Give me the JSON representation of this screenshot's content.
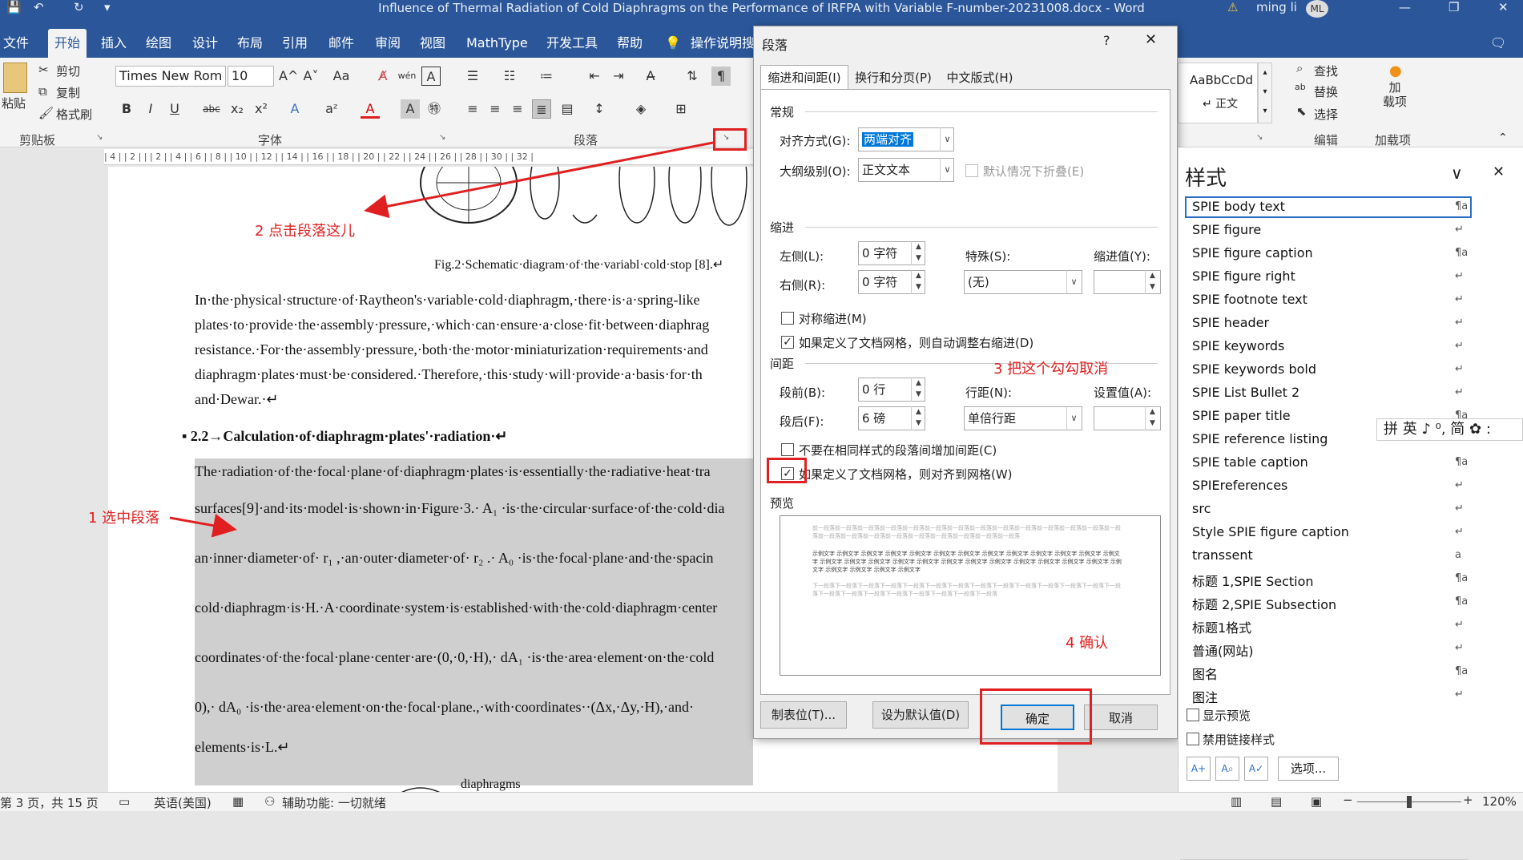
{
  "titlebar": {
    "title": "Influence of Thermal Radiation of Cold Diaphragms on the Performance of IRFPA with Variable F-number-20231008.docx  -  Word",
    "user": "ming li",
    "avatar": "ML",
    "min": "—",
    "restore": "❐",
    "close": "✕",
    "save": "💾",
    "undo": "↶",
    "redo": "↻",
    "customize": "▾",
    "warn": "⚠"
  },
  "ribbon": {
    "tabs": [
      "文件",
      "开始",
      "插入",
      "绘图",
      "设计",
      "布局",
      "引用",
      "邮件",
      "审阅",
      "视图",
      "MathType",
      "开发工具",
      "帮助",
      "操作说明搜"
    ],
    "tell_icon": "💡",
    "comment_icon": "🗨",
    "clipboard": {
      "paste": "粘贴",
      "cut": "剪切",
      "copy": "复制",
      "painter": "格式刷",
      "label": "剪贴板"
    },
    "font": {
      "name": "Times New Rom",
      "size": "10",
      "label": "字体",
      "bold": "B",
      "italic": "I",
      "underline": "U",
      "strike": "abc",
      "sub": "x₂",
      "sup": "x²",
      "grow": "A^",
      "shrink": "A˅",
      "case": "Aa",
      "clear": "A̸",
      "phon": "wén",
      "border": "A",
      "effect": "A",
      "hilite": "aᶻ",
      "color": "A",
      "shade": "A",
      "circ": "㊕"
    },
    "paragraph": {
      "label": "段落"
    },
    "styles": {
      "preview": "AaBbCcDd",
      "name": "↵ 正文"
    },
    "editing": {
      "find": "查找",
      "replace": "替换",
      "select": "选择",
      "label": "编辑"
    },
    "addins": {
      "name": "加\n载项",
      "label": "加载项",
      "icon": "●"
    }
  },
  "ruler": "| 4 |   | 2 |   |   | 2 |   | 4 |   | 6 |   | 8 |   | 10 |   | 12 |   | 14 |   | 16 |   | 18 |   | 20 |   | 22 |   | 24 |   | 26 |   | 28 |   | 30 |   | 32 |",
  "doc": {
    "caption": "Fig.2·Schematic·diagram·of·the·variabl·cold·stop [8].↵",
    "p1": [
      "In·the·physical·structure·of·Raytheon's·variable·cold·diaphragm,·there·is·a·spring-like",
      "plates·to·provide·the·assembly·pressure,·which·can·ensure·a·close·fit·between·diaphrag",
      "resistance.·For·the·assembly·pressure,·both·the·motor·miniaturization·requirements·and",
      "diaphragm·plates·must·be·considered.·Therefore,·this·study·will·provide·a·basis·for·th",
      "and·Dewar.·↵"
    ],
    "heading": "▪ 2.2→Calculation·of·diaphragm·plates'·radiation·↵",
    "p2": [
      "The·radiation·of·the·focal·plane·of·diaphragm·plates·is·essentially·the·radiative·heat·tra",
      "surfaces[9]·and·its·model·is·shown·in·Figure·3.·  A₁ ·is·the·circular·surface·of·the·cold·dia",
      "an·inner·diameter·of·  r₁ ,·an·outer·diameter·of·  r₂ .·  A₀ ·is·the·focal·plane·and·the·spacin",
      "cold·diaphragm·is·H.·A·coordinate·system·is·established·with·the·cold·diaphragm·center",
      "coordinates·of·the·focal·plane·center·are·(0,·0,·H),·  dA₁ ·is·the·area·element·on·the·cold",
      "0),·  dA₀ ·is·the·area·element·on·the·focal·plane.,·with·coordinates··(Δx,·Δy,·H),·and·",
      "elements·is·L.↵"
    ],
    "fig3": "diaphragms"
  },
  "dialog": {
    "title": "段落",
    "help": "?",
    "close": "✕",
    "tabs": [
      "缩进和间距(I)",
      "换行和分页(P)",
      "中文版式(H)"
    ],
    "general": "常规",
    "align_label": "对齐方式(G):",
    "align_value": "两端对齐",
    "outline_label": "大纲级别(O):",
    "outline_value": "正文文本",
    "collapse_label": "默认情况下折叠(E)",
    "indent": "缩进",
    "left_label": "左侧(L):",
    "left_value": "0 字符",
    "right_label": "右侧(R):",
    "right_value": "0 字符",
    "special_label": "特殊(S):",
    "special_value": "(无)",
    "indentby_label": "缩进值(Y):",
    "indentby_value": "",
    "mirror_label": "对称缩进(M)",
    "autoright_label": "如果定义了文档网格，则自动调整右缩进(D)",
    "spacing": "间距",
    "before_label": "段前(B):",
    "before_value": "0 行",
    "after_label": "段后(F):",
    "after_value": "6 磅",
    "line_label": "行距(N):",
    "line_value": "单倍行距",
    "at_label": "设置值(A):",
    "at_value": "",
    "nospace_label": "不要在相同样式的段落间增加间距(C)",
    "snap_label": "如果定义了文档网格，则对齐到网格(W)",
    "preview": "预览",
    "preview_prev": "前一段落前一段落前一段落前一段落前一段落前一段落前一段落前一段落前一段落前一段落前一段落前一段落前一段落前一段落前一段落前一段落前一段落前一段落前一段落前一段落前一段落前一段落前一段落",
    "preview_cur": "示例文字 示例文字 示例文字 示例文字 示例文字 示例文字 示例文字 示例文字 示例文字 示例文字 示例文字 示例文字 示例文字 示例文字 示例文字 示例文字 示例文字 示例文字 示例文字 示例文字 示例文字 示例文字 示例文字 示例文字 示例文字 示例文字 示例文字 示例文字 示例文字 示例文字",
    "preview_next": "下一段落下一段落下一段落下一段落下一段落下一段落下一段落下一段落下一段落下一段落下一段落下一段落下一段落下一段落下一段落下一段落下一段落下一段落下一段落下一段落下一段落下一段落",
    "tabs_btn": "制表位(T)...",
    "default_btn": "设为默认值(D)",
    "ok": "确定",
    "cancel": "取消"
  },
  "styles_panel": {
    "title": "样式",
    "chevron": "∨",
    "close": "✕",
    "items": [
      {
        "name": "SPIE body text",
        "mark": "¶a"
      },
      {
        "name": "SPIE figure",
        "mark": "↵"
      },
      {
        "name": "SPIE figure caption",
        "mark": "¶a"
      },
      {
        "name": "SPIE figure right",
        "mark": "↵"
      },
      {
        "name": "SPIE footnote text",
        "mark": "↵"
      },
      {
        "name": "SPIE header",
        "mark": "↵"
      },
      {
        "name": "SPIE keywords",
        "mark": "↵"
      },
      {
        "name": "SPIE keywords bold",
        "mark": "↵"
      },
      {
        "name": "SPIE List Bullet 2",
        "mark": "↵"
      },
      {
        "name": "SPIE paper title",
        "mark": "¶a"
      },
      {
        "name": "SPIE reference listing",
        "mark": "↵"
      },
      {
        "name": "SPIE table caption",
        "mark": "¶a"
      },
      {
        "name": "SPIEreferences",
        "mark": "↵"
      },
      {
        "name": "src",
        "mark": "↵"
      },
      {
        "name": "Style SPIE figure caption",
        "mark": "↵"
      },
      {
        "name": "transsent",
        "mark": "a"
      },
      {
        "name": "标题 1,SPIE Section",
        "mark": "¶a"
      },
      {
        "name": "标题 2,SPIE Subsection",
        "mark": "¶a"
      },
      {
        "name": "标题1格式",
        "mark": "↵"
      },
      {
        "name": "普通(网站)",
        "mark": "↵"
      },
      {
        "name": "图名",
        "mark": "¶a"
      },
      {
        "name": "图注",
        "mark": "↵"
      }
    ],
    "show_preview": "显示预览",
    "disable_linked": "禁用链接样式",
    "options": "选项...",
    "new_style": "A+",
    "inspector": "A⌕",
    "manage": "A✓"
  },
  "ime": "拼 英 ♪ ⁰, 简 ✿ :",
  "status": {
    "page": "第 3 页，共 15 页",
    "lang": "英语(美国)",
    "accessibility": "辅助功能: 一切就绪",
    "zoom": "120%",
    "zoom_out": "−",
    "zoom_in": "+"
  },
  "annotations": {
    "a1": "1  选中段落",
    "a2": "2 点击段落这儿",
    "a3": "3 把这个勾勾取消",
    "a4": "4 确认"
  }
}
